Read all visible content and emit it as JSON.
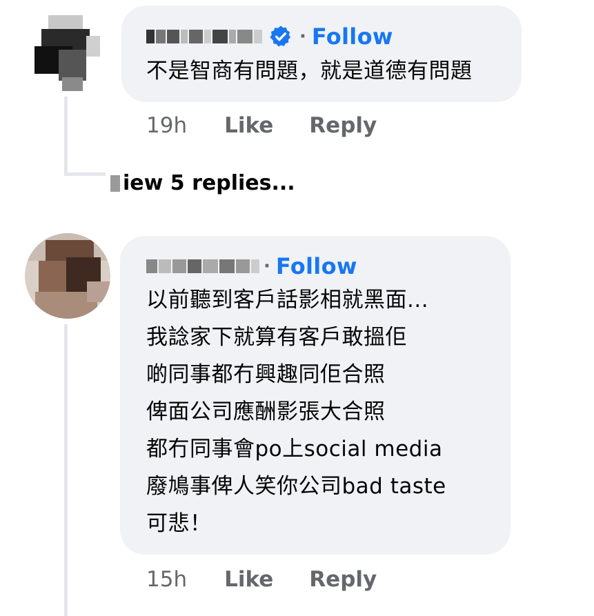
{
  "comments": [
    {
      "author_blurred": true,
      "verified": true,
      "separator": "·",
      "follow_label": "Follow",
      "text": "不是智商有問題，就是道德有問題",
      "time": "19h",
      "like_label": "Like",
      "reply_label": "Reply",
      "view_replies": "iew 5 replies..."
    },
    {
      "author_blurred": true,
      "verified": false,
      "separator": "·",
      "follow_label": "Follow",
      "text": "以前聽到客戶話影相就黑面...\n我諗家下就算有客戶敢搵佢\n啲同事都冇興趣同佢合照\n俾面公司應酬影張大合照\n都冇同事會po上social media\n廢鳩事俾人笑你公司bad taste\n可悲！",
      "time": "15h",
      "like_label": "Like",
      "reply_label": "Reply"
    }
  ],
  "colors": {
    "bubble": "#f0f2f5",
    "follow": "#1877f2",
    "meta": "#65676b",
    "verified": "#1877f2"
  }
}
